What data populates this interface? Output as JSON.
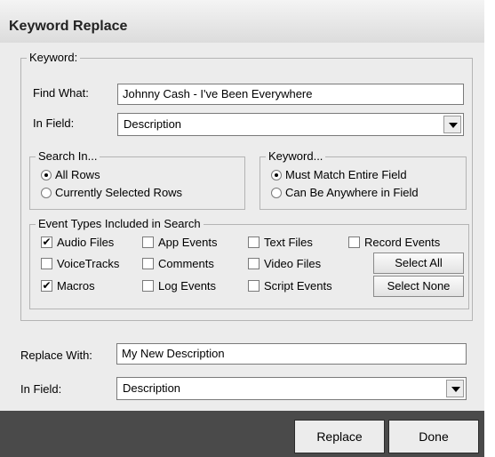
{
  "dialog": {
    "title": "Keyword Replace"
  },
  "keyword_group": {
    "legend": "Keyword:",
    "find_label": "Find What:",
    "find_value": "Johnny Cash - I've Been Everywhere",
    "field_label": "In Field:",
    "field_value": "Description"
  },
  "search_in": {
    "legend": "Search In...",
    "options": [
      {
        "label": "All Rows",
        "selected": true
      },
      {
        "label": "Currently Selected Rows",
        "selected": false
      }
    ]
  },
  "keyword_match": {
    "legend": "Keyword...",
    "options": [
      {
        "label": "Must Match Entire Field",
        "selected": true
      },
      {
        "label": "Can Be Anywhere in Field",
        "selected": false
      }
    ]
  },
  "event_types": {
    "legend": "Event Types Included in Search",
    "items": [
      {
        "label": "Audio Files",
        "checked": true
      },
      {
        "label": "App Events",
        "checked": false
      },
      {
        "label": "Text Files",
        "checked": false
      },
      {
        "label": "Record Events",
        "checked": false
      },
      {
        "label": "VoiceTracks",
        "checked": false
      },
      {
        "label": "Comments",
        "checked": false
      },
      {
        "label": "Video Files",
        "checked": false
      },
      {
        "label": "Macros",
        "checked": true
      },
      {
        "label": "Log Events",
        "checked": false
      },
      {
        "label": "Script Events",
        "checked": false
      }
    ],
    "select_all": "Select All",
    "select_none": "Select None"
  },
  "replace": {
    "label": "Replace With:",
    "value": "My New Description",
    "field_label": "In Field:",
    "field_value": "Description"
  },
  "footer": {
    "replace_button": "Replace",
    "done_button": "Done"
  }
}
